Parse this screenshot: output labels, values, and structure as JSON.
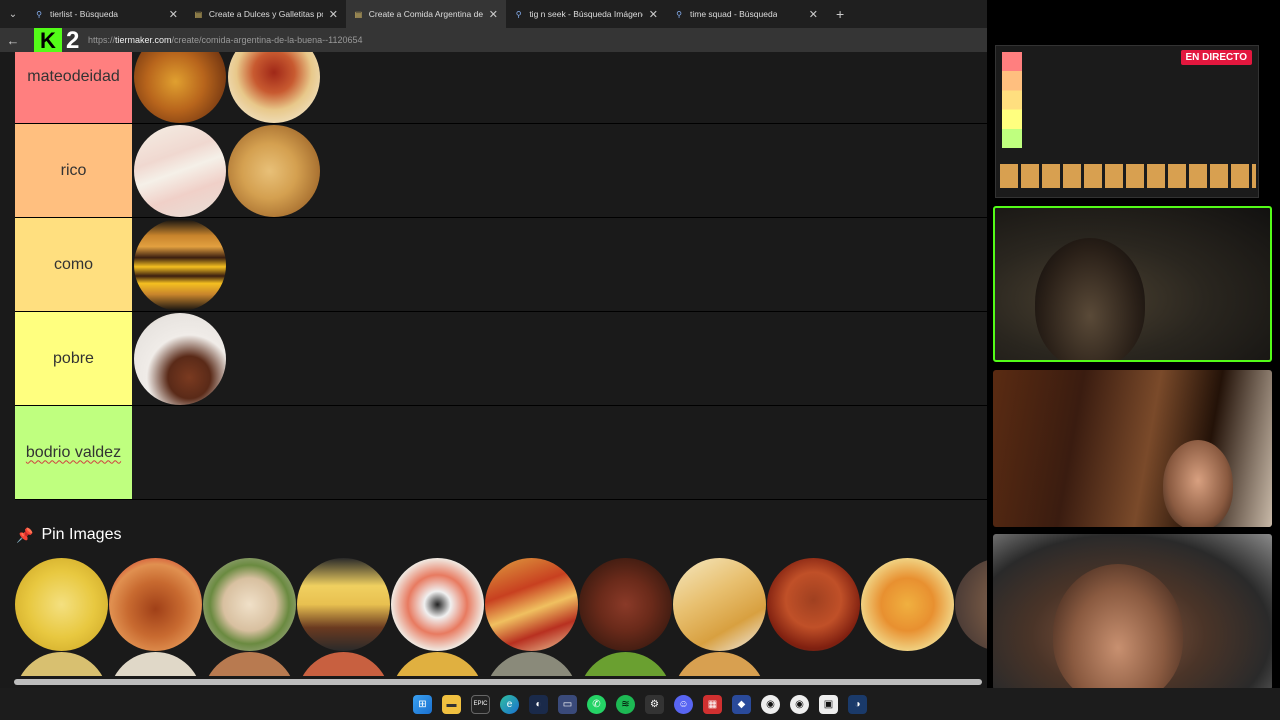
{
  "browser": {
    "tabs": [
      {
        "title": "tierlist - Búsqueda",
        "active": false,
        "icon": "search-icon"
      },
      {
        "title": "Create a Dulces y Galletitas popul",
        "active": false,
        "icon": "tiermaker-icon"
      },
      {
        "title": "Create a Comida Argentina de la b",
        "active": true,
        "icon": "tiermaker-icon"
      },
      {
        "title": "tig n seek - Búsqueda Imágenes",
        "active": false,
        "icon": "search-icon"
      },
      {
        "title": "time squad - Búsqueda",
        "active": false,
        "icon": "search-icon"
      }
    ],
    "url_prefix": "https://",
    "url_host": "tiermaker.com",
    "url_path": "/create/comida-argentina-de-la-buena--1120654",
    "logo_text": "2"
  },
  "tiers": [
    {
      "label": "mateodeidad",
      "color": "#ff7f7f"
    },
    {
      "label": "rico",
      "color": "#ffbf7f"
    },
    {
      "label": "como",
      "color": "#ffdf7f"
    },
    {
      "label": "pobre",
      "color": "#ffff7f"
    },
    {
      "label": "bodrio valdez",
      "color": "#bfff7f"
    }
  ],
  "pool": {
    "title": "Pin Images"
  },
  "stream": {
    "live_label": "EN DIRECTO"
  }
}
